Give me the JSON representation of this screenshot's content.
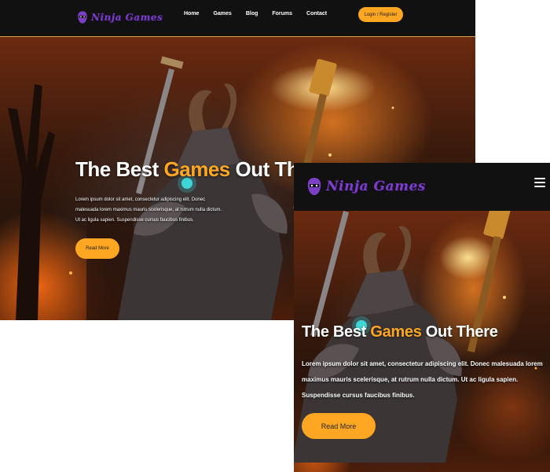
{
  "brand": {
    "name": "Ninja Games",
    "colors": {
      "accent": "#ffa722",
      "logo": "#7b3fc4",
      "nav_bg": "#111111",
      "text": "#ffffff"
    }
  },
  "nav": {
    "links": [
      "Home",
      "Games",
      "Blog",
      "Forums",
      "Contact"
    ],
    "login_label": "Login / Register",
    "menu_icon": "hamburger-icon"
  },
  "hero": {
    "title_start": "The Best ",
    "title_highlight": "Games",
    "title_end": " Out There",
    "description": "Lorem ipsum dolor sit amet, consectetur adipiscing elit. Donec malesuada lorem maximus mauris scelerisque, at rutrum nulla dictum. Ut ac ligula sapien. Suspendisse cursus faucibus finibus.",
    "button_label": "Read More"
  }
}
